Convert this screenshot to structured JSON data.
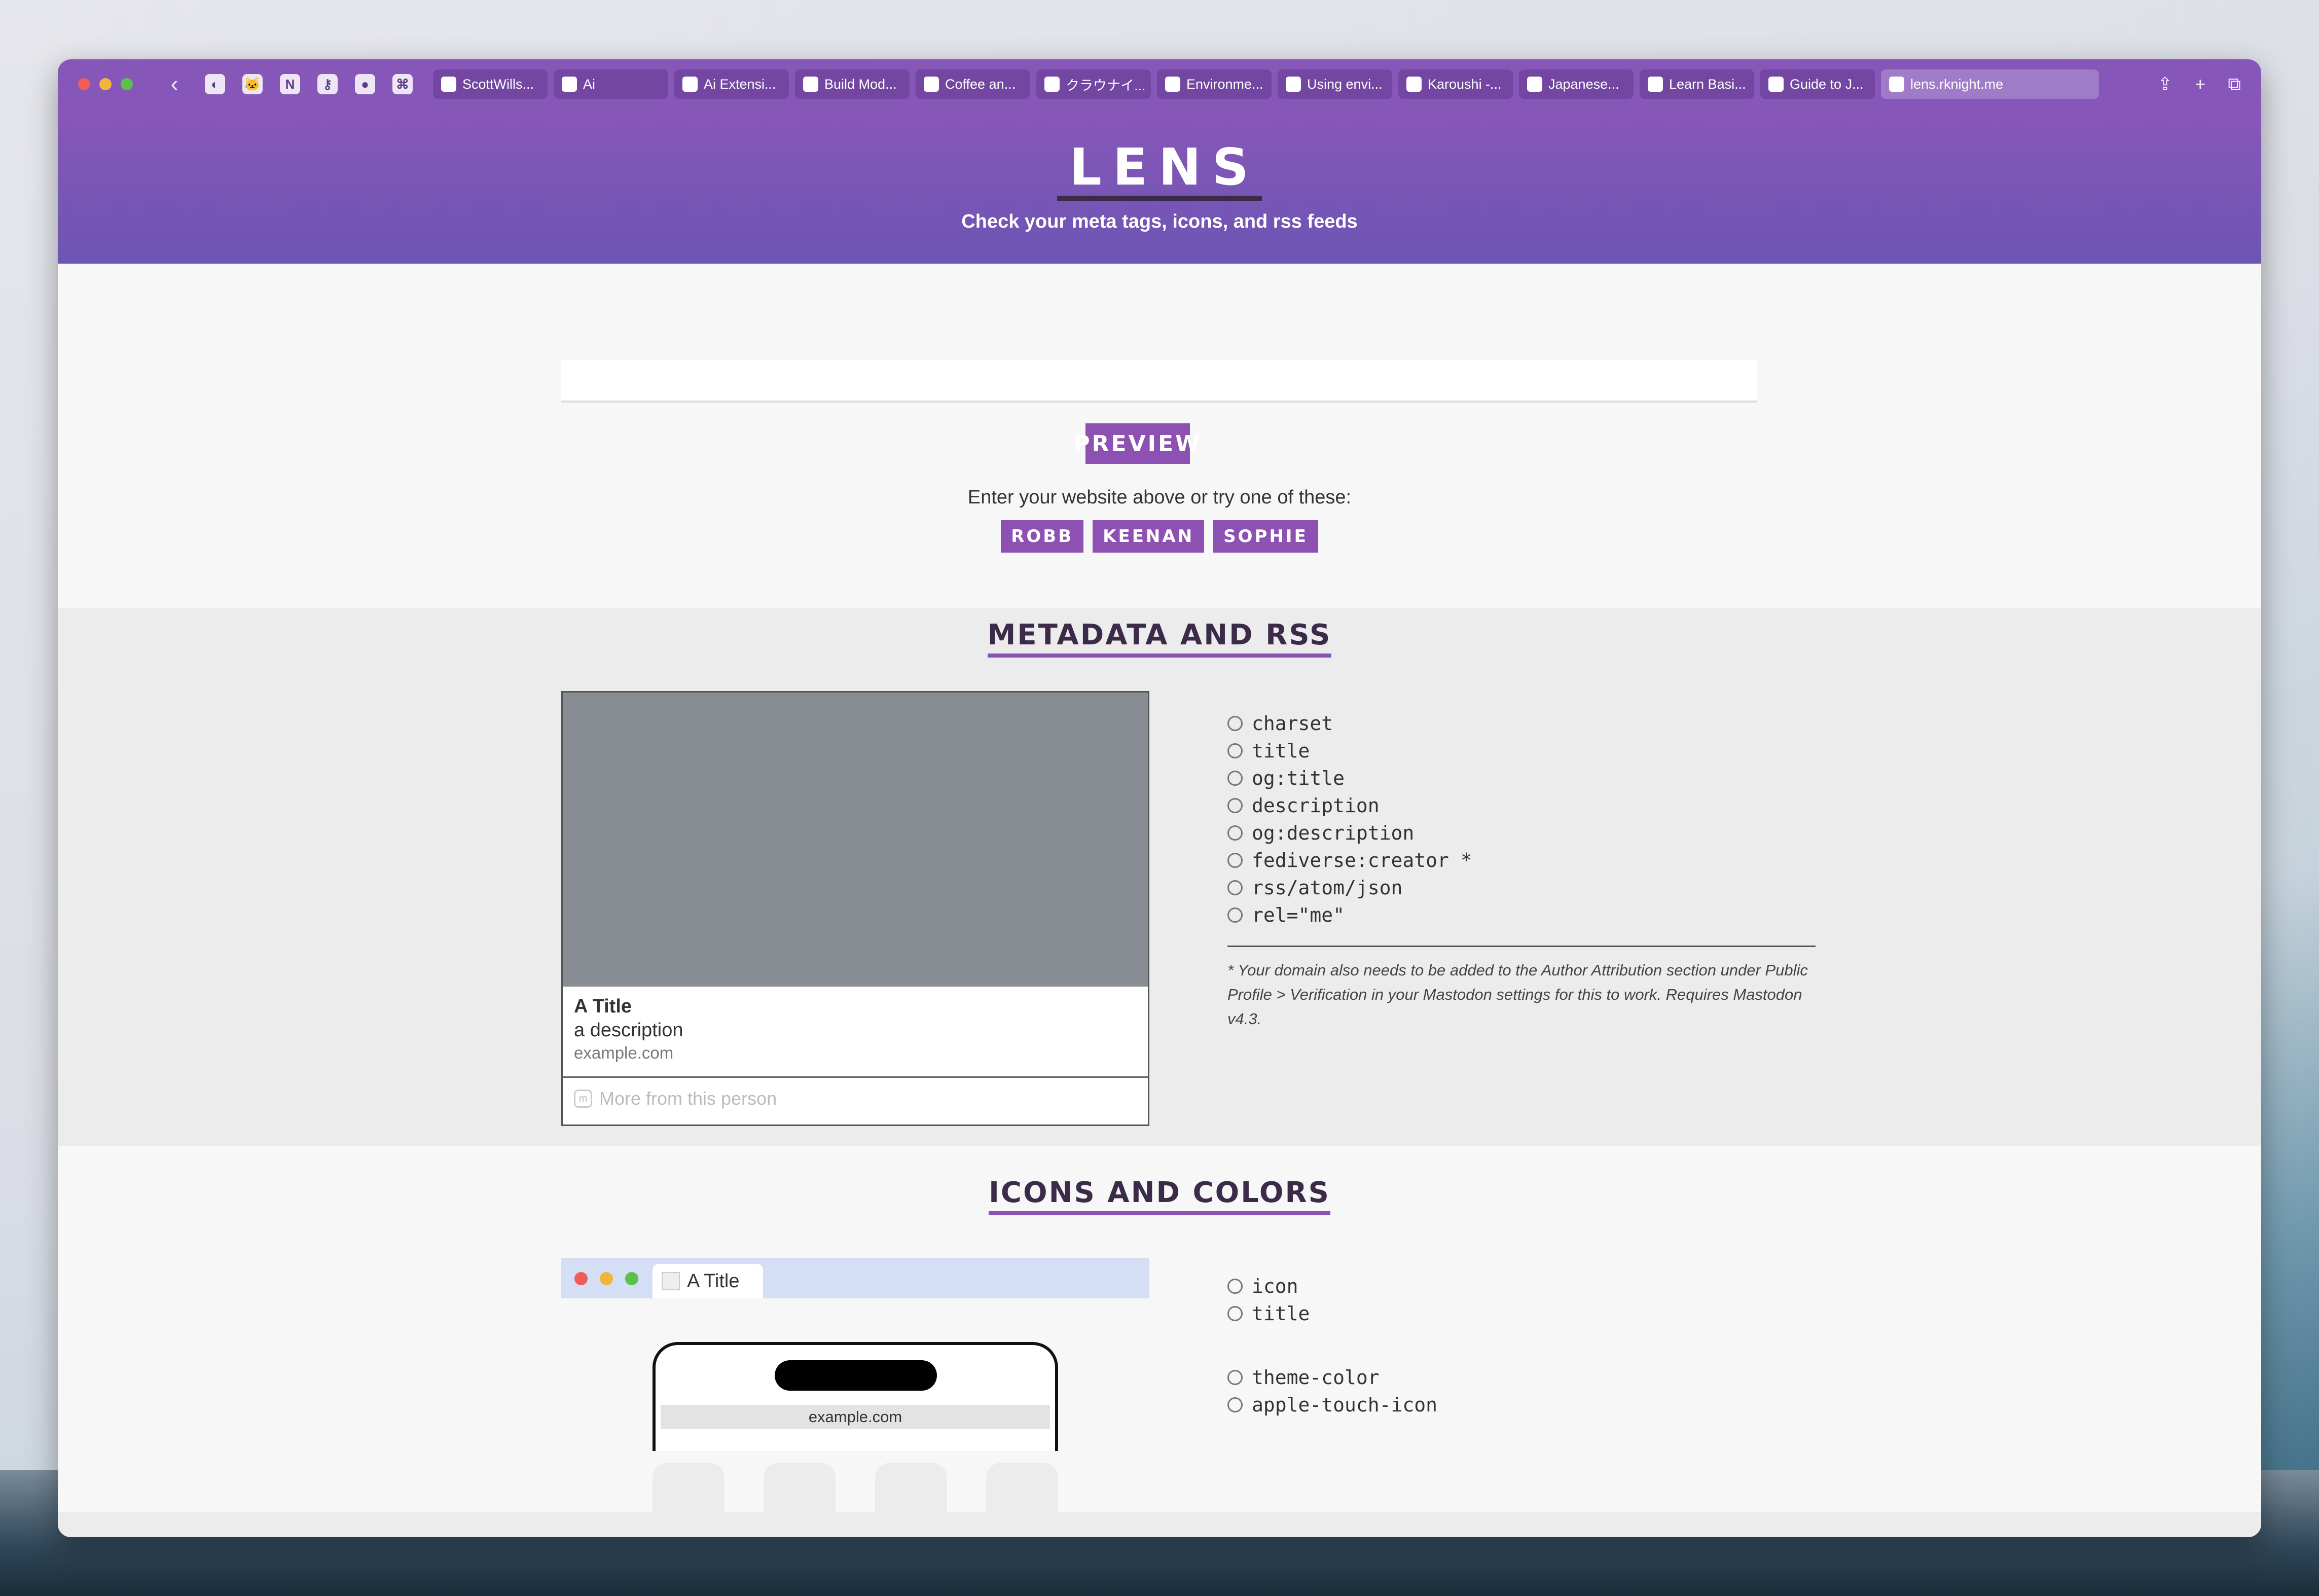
{
  "browser": {
    "back_icon": "‹",
    "toolbar_icons": [
      {
        "name": "sidebar-icon",
        "glyph": "◐"
      },
      {
        "name": "extension-cat-icon",
        "glyph": "🐱"
      },
      {
        "name": "notion-icon",
        "glyph": "N"
      },
      {
        "name": "key-icon",
        "glyph": "⚷"
      },
      {
        "name": "record-icon",
        "glyph": "●"
      },
      {
        "name": "flow-icon",
        "glyph": "⌘"
      }
    ],
    "tabs": [
      "ScottWills...",
      "Ai",
      "Ai Extensi...",
      "Build Mod...",
      "Coffee an...",
      "クラウナイ...",
      "Environme...",
      "Using envi...",
      "Karoushi -...",
      "Japanese...",
      "Learn Basi...",
      "Guide to J..."
    ],
    "active_tab": "lens.rknight.me",
    "right_icons": [
      "⇪",
      "+",
      "⧉"
    ]
  },
  "header": {
    "logo": "LENS",
    "tagline": "Check your meta tags, icons, and rss feeds"
  },
  "search": {
    "value": "",
    "button": "PREVIEW",
    "try_text": "Enter your website above or try one of these:",
    "samples": [
      "ROBB",
      "KEENAN",
      "SOPHIE"
    ]
  },
  "metadata": {
    "title": "METADATA AND RSS",
    "card": {
      "title": "A Title",
      "description": "a description",
      "domain": "example.com",
      "more": "More from this person"
    },
    "checks": [
      "charset",
      "title",
      "og:title",
      "description",
      "og:description",
      "fediverse:creator *",
      "rss/atom/json",
      "rel=\"me\""
    ],
    "footnote": "* Your domain also needs to be added to the Author Attribution section under Public Profile > Verification in your Mastodon settings for this to work. Requires Mastodon v4.3."
  },
  "icons": {
    "title": "ICONS AND COLORS",
    "mock_tab_title": "A Title",
    "phone_domain": "example.com",
    "checks_a": [
      "icon",
      "title"
    ],
    "checks_b": [
      "theme-color",
      "apple-touch-icon"
    ]
  },
  "colors": {
    "accent": "#8c51b3",
    "header_start": "#8856b8",
    "header_end": "#6c55b4",
    "text_dark": "#3b2b48"
  }
}
